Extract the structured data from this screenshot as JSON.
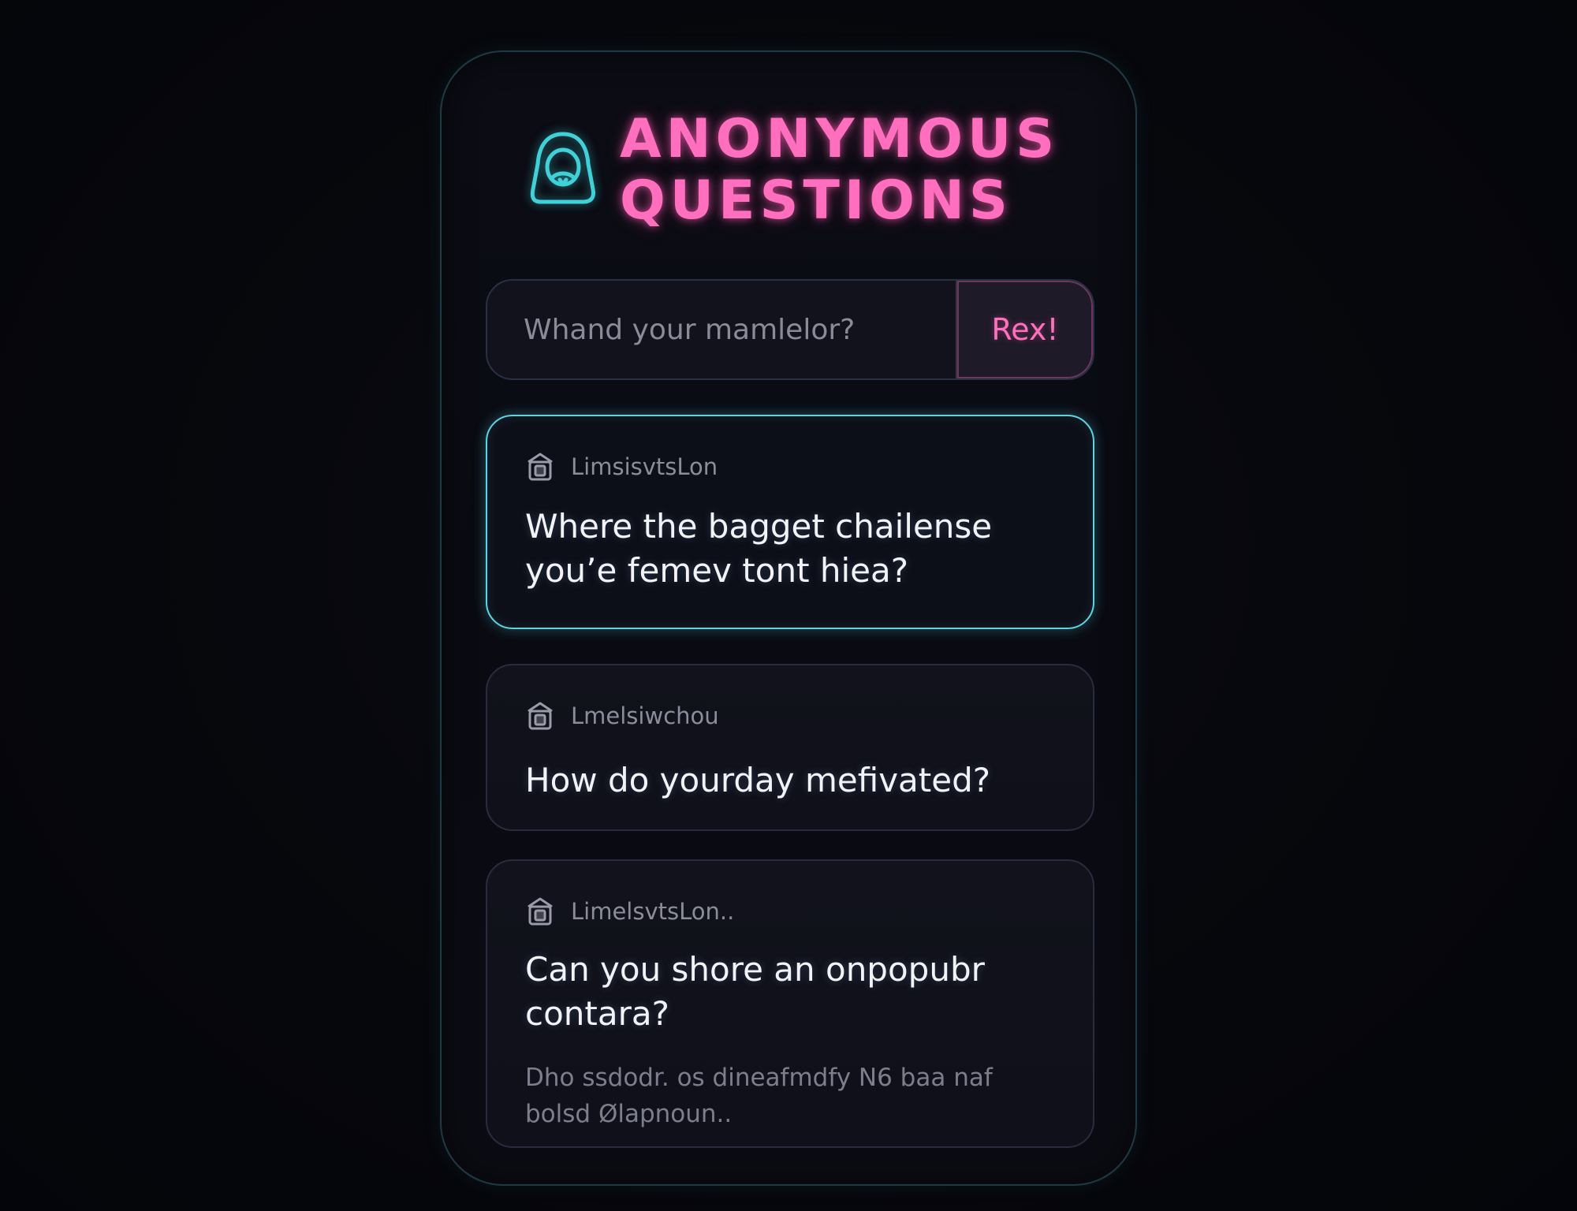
{
  "app": {
    "title_line1": "ANONYMOUS",
    "title_line2": "QUESTIONS",
    "logo_icon": "hooded-figure-icon"
  },
  "ask_form": {
    "input_placeholder": "Whand your mamlelor?",
    "input_value": "",
    "submit_label": "Rex!"
  },
  "questions": [
    {
      "icon": "anonymous-user-icon",
      "author": "LimsisvtsLon",
      "text": "Where the bagget chailense you’e femev tont hiea?",
      "active": true
    },
    {
      "icon": "anonymous-user-icon",
      "author": "Lmelsiwchou",
      "text": "How do yourday mefivated?",
      "active": false
    },
    {
      "icon": "anonymous-user-icon",
      "author": "LimelsvtsLon..",
      "text": "Can you shore an onpopubr contara?",
      "answer": "Dho ssdodr. os dineafmdfy N6 baa naf bolsd Ølapnoun..",
      "active": false
    }
  ],
  "colors": {
    "accent_pink": "#ff6fbd",
    "accent_cyan": "#5fd3e0",
    "background": "#05060b",
    "card_bg": "#11121b"
  }
}
